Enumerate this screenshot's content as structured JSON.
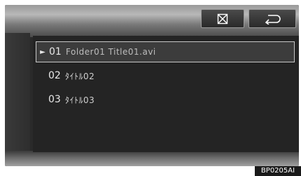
{
  "toolbar": {
    "close_icon": "close-box-icon",
    "back_icon": "return-arrow-icon"
  },
  "list": {
    "items": [
      {
        "number": "01",
        "title": "Folder01 Title01.avi",
        "selected": true
      },
      {
        "number": "02",
        "title": "ﾀｲﾄﾙ02",
        "selected": false
      },
      {
        "number": "03",
        "title": "ﾀｲﾄﾙ03",
        "selected": false
      }
    ],
    "selected_marker": "►"
  },
  "caption": "BP0205AI",
  "colors": {
    "panel_bg": "#242424",
    "selected_border": "#c8c8c8",
    "text": "#e8e8e8"
  }
}
